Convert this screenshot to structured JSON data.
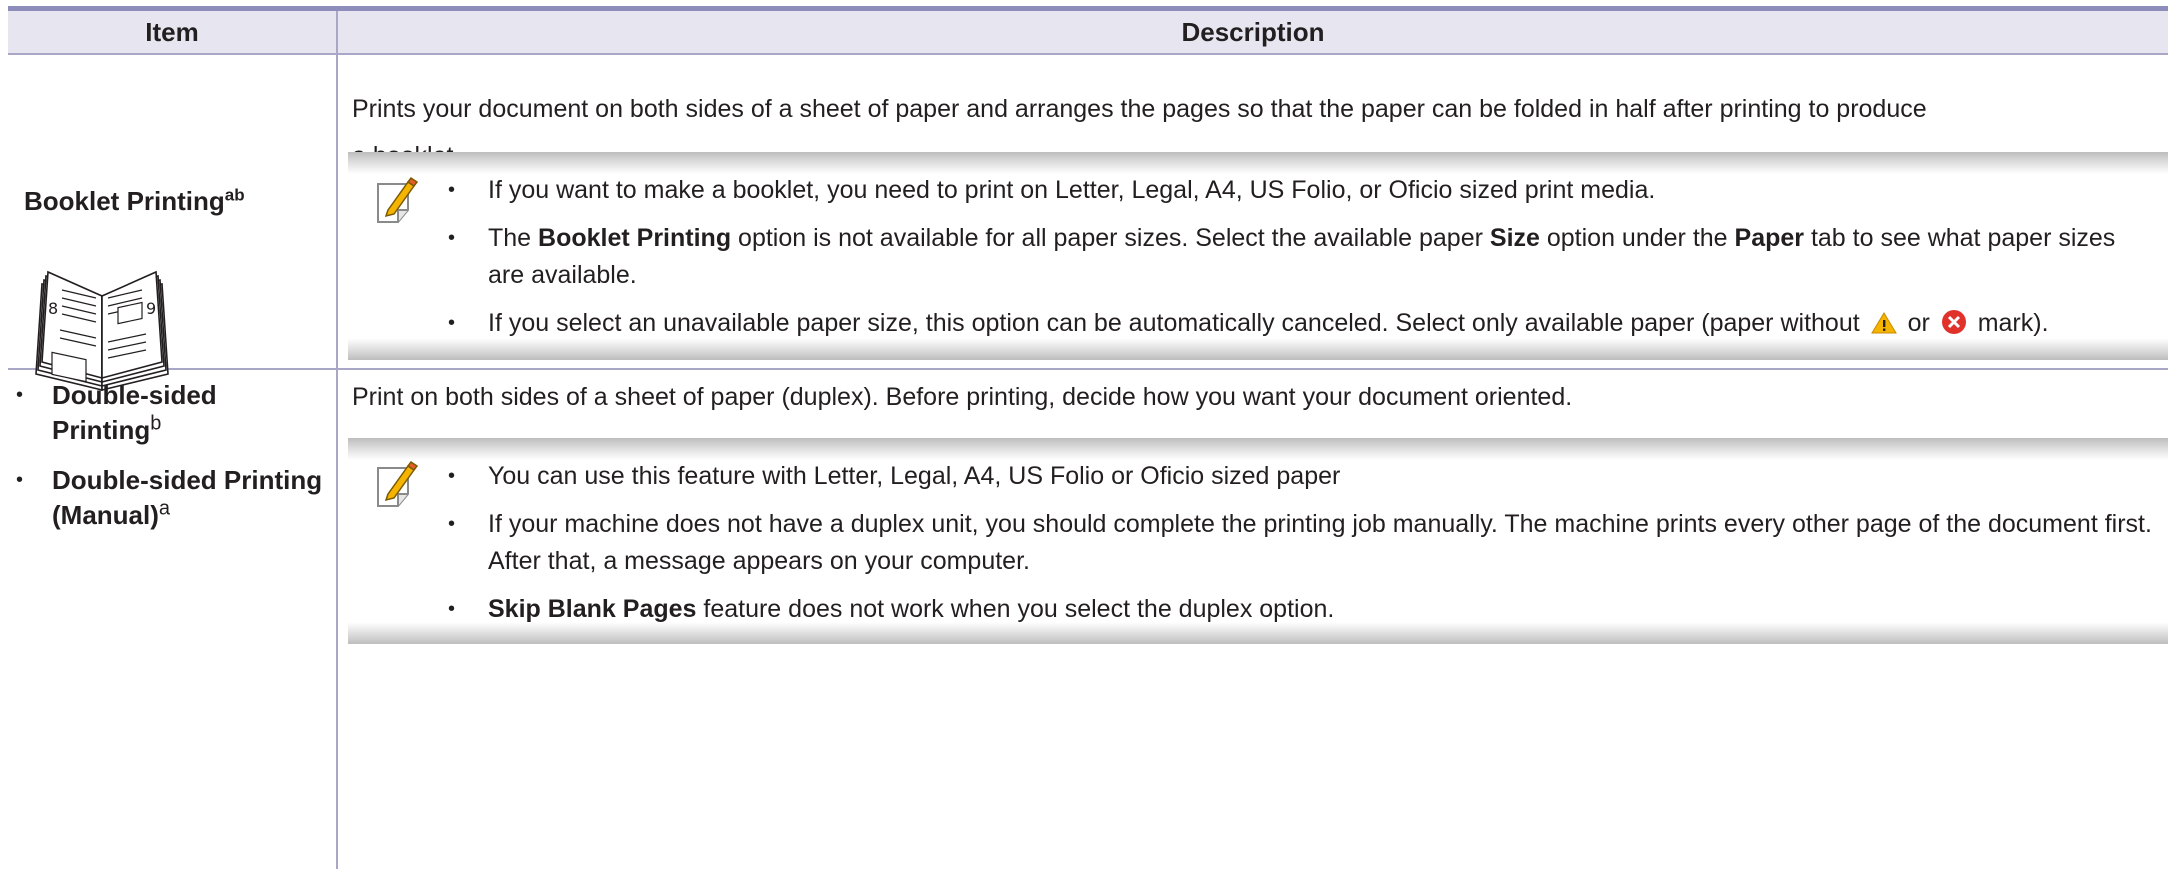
{
  "header": {
    "item": "Item",
    "description": "Description"
  },
  "row1": {
    "title": "Booklet Printing",
    "title_sup": "ab",
    "icon": "booklet-icon",
    "description_line1": "Prints your document on both sides of a sheet of paper and arranges the pages so that the paper can be folded in half after printing to produce",
    "description_line2": "a booklet.",
    "note_icon": "note-pencil-icon",
    "notes": [
      {
        "text": "If you want to make a booklet, you need to print on Letter, Legal, A4, US Folio, or Oficio sized print media."
      },
      {
        "pre": "The ",
        "bold1": "Booklet Printing",
        "mid1": " option is not available for all paper sizes. Select the available paper ",
        "bold2": "Size",
        "mid2": " option under the ",
        "bold3": "Paper",
        "post": " tab to see what paper sizes are available."
      },
      {
        "pre": "If you select an unavailable paper size, this option can be automatically canceled. Select only available paper (paper without ",
        "or": " or ",
        "post": " mark).",
        "icon1": "warning-icon",
        "icon2": "error-icon"
      }
    ]
  },
  "row2": {
    "items": [
      {
        "label": "Double-sided Printing",
        "sup": "b"
      },
      {
        "label": "Double-sided Printing (Manual)",
        "sup": "a"
      }
    ],
    "description": "Print on both sides of a sheet of paper (duplex). Before printing, decide how you want your document oriented.",
    "note_icon": "note-pencil-icon",
    "notes": [
      {
        "text": "You can use this feature with Letter, Legal, A4, US Folio or Oficio sized paper"
      },
      {
        "text": "If your machine does not have a duplex unit, you should complete the printing job manually. The machine prints every other page of the document first. After that, a message appears on your computer."
      },
      {
        "bold": "Skip Blank Pages",
        "post": " feature does not work when you select the duplex option."
      }
    ]
  },
  "bullet": "•",
  "colors": {
    "header_bg": "#e7e6f0",
    "rule": "#8e8cbb",
    "grid": "#a9a7c8",
    "text": "#231f20"
  }
}
